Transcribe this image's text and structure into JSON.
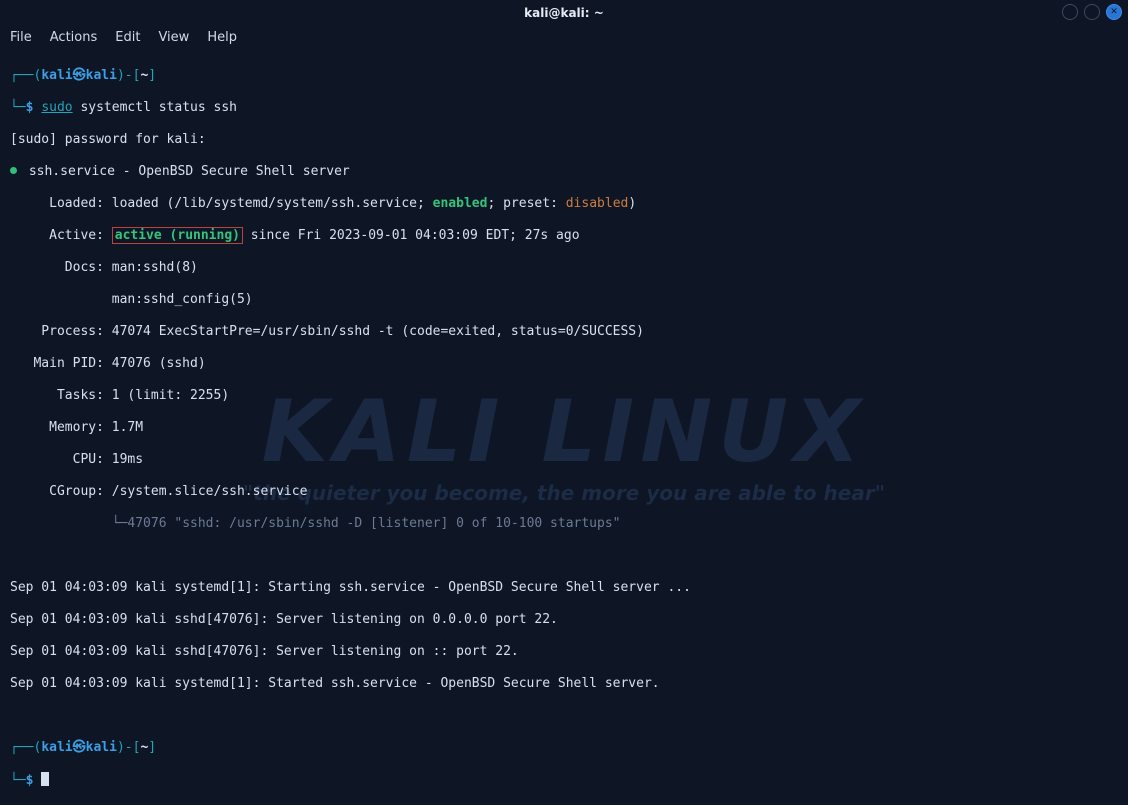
{
  "window": {
    "title": "kali@kali: ~"
  },
  "menu": {
    "file": "File",
    "actions": "Actions",
    "edit": "Edit",
    "view": "View",
    "help": "Help"
  },
  "prompt1": {
    "open": "┌──(",
    "user": "kali",
    "skull": "㉿",
    "host": "kali",
    "close": ")-[",
    "path": "~",
    "end": "]",
    "sigil_line": "└─",
    "sigil": "$",
    "cmd_sudo": "sudo",
    "cmd_rest": " systemctl status ssh"
  },
  "out": {
    "pwd": "[sudo] password for kali:",
    "svc_label": " ssh.service - OpenBSD Secure Shell server",
    "loaded_label": "     Loaded: ",
    "loaded_val1": "loaded (/lib/systemd/system/ssh.service; ",
    "loaded_enabled": "enabled",
    "loaded_val2": "; preset: ",
    "loaded_disabled": "disabled",
    "loaded_val3": ")",
    "active_label": "     Active: ",
    "active_state": "active (running)",
    "active_tail": " since Fri 2023-09-01 04:03:09 EDT; 27s ago",
    "docs_label": "       Docs: ",
    "docs1": "man:sshd(8)",
    "docs2": "             man:sshd_config(5)",
    "process": "    Process: 47074 ExecStartPre=/usr/sbin/sshd -t (code=exited, status=0/SUCCESS)",
    "mainpid": "   Main PID: 47076 (sshd)",
    "tasks": "      Tasks: 1 (limit: 2255)",
    "memory": "     Memory: 1.7M",
    "cpu": "        CPU: 19ms",
    "cgroup_label": "     CGroup: ",
    "cgroup_val": "/system.slice/ssh.service",
    "cgroup_tree": "             └─",
    "cgroup_proc": "47076 \"sshd: /usr/sbin/sshd -D [listener] 0 of 10-100 startups\"",
    "log1": "Sep 01 04:03:09 kali systemd[1]: Starting ssh.service - OpenBSD Secure Shell server ...",
    "log2": "Sep 01 04:03:09 kali sshd[47076]: Server listening on 0.0.0.0 port 22.",
    "log3": "Sep 01 04:03:09 kali sshd[47076]: Server listening on :: port 22.",
    "log4": "Sep 01 04:03:09 kali systemd[1]: Started ssh.service - OpenBSD Secure Shell server."
  },
  "prompt2": {
    "open": "┌──(",
    "user": "kali",
    "skull": "㉿",
    "host": "kali",
    "close": ")-[",
    "path": "~",
    "end": "]",
    "sigil_line": "└─",
    "sigil": "$"
  },
  "bg": {
    "logo": "KALI LINUX",
    "tagline": "\"the quieter you become, the more you are able to hear\""
  }
}
